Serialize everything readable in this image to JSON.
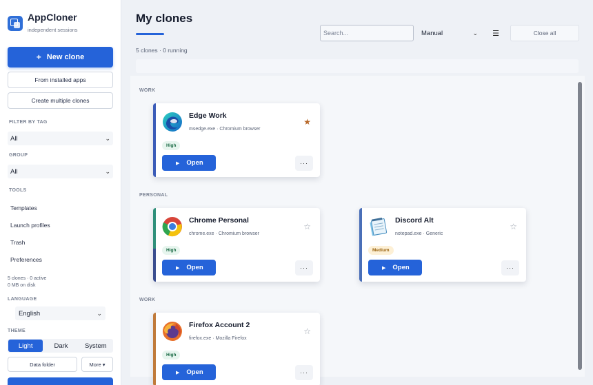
{
  "app": {
    "name": "AppCloner",
    "tagline": "independent sessions"
  },
  "sidebar": {
    "new_clone": "New clone",
    "new_clone_icon": "+",
    "from_installed": "From installed apps",
    "create_multiple": "Create multiple clones",
    "filter_label": "FILTER BY TAG",
    "filter_value": "All",
    "group_label": "GROUP",
    "group_value": "All",
    "tools_label": "TOOLS",
    "tools": [
      "Templates",
      "Launch profiles",
      "Trash",
      "Preferences"
    ],
    "stats_line1": "5 clones · 0 active",
    "stats_line2": "0 MB on disk",
    "language_label": "LANGUAGE",
    "language_value": "English",
    "theme_label": "THEME",
    "theme_options": [
      "Light",
      "Dark",
      "System"
    ],
    "theme_selected": "Light",
    "data_folder": "Data folder",
    "more": "More ▾"
  },
  "main": {
    "title": "My clones",
    "subtitle": "5 clones · 0 running",
    "search_placeholder": "Search...",
    "sort_value": "Manual",
    "close_all": "Close all",
    "groups": [
      "WORK",
      "PERSONAL",
      "WORK"
    ]
  },
  "cards": [
    {
      "name": "Edge Work",
      "exe": "msedge.exe",
      "type": "Chromium browser",
      "badge": "High",
      "starred": true,
      "accent": "#3a5bb8",
      "icon": "edge-icon"
    },
    {
      "name": "Chrome Personal",
      "exe": "chrome.exe",
      "type": "Chromium browser",
      "badge": "High",
      "starred": false,
      "accent": "#2f8f7a",
      "icon": "chrome-icon"
    },
    {
      "name": "Discord Alt",
      "exe": "notepad.exe",
      "type": "Generic",
      "badge": "Medium",
      "starred": false,
      "accent": "#4a6fb8",
      "icon": "notepad-icon"
    },
    {
      "name": "Firefox Account 2",
      "exe": "firefox.exe",
      "type": "Mozilla Firefox",
      "badge": "High",
      "starred": false,
      "accent": "#c07a3a",
      "icon": "firefox-icon"
    }
  ],
  "labels": {
    "open": "Open",
    "more_dots": "···",
    "star_filled": "★",
    "star_empty": "☆",
    "sep": "·"
  },
  "colors": {
    "accent": "#2563d9",
    "star_active": "#b8692a"
  }
}
